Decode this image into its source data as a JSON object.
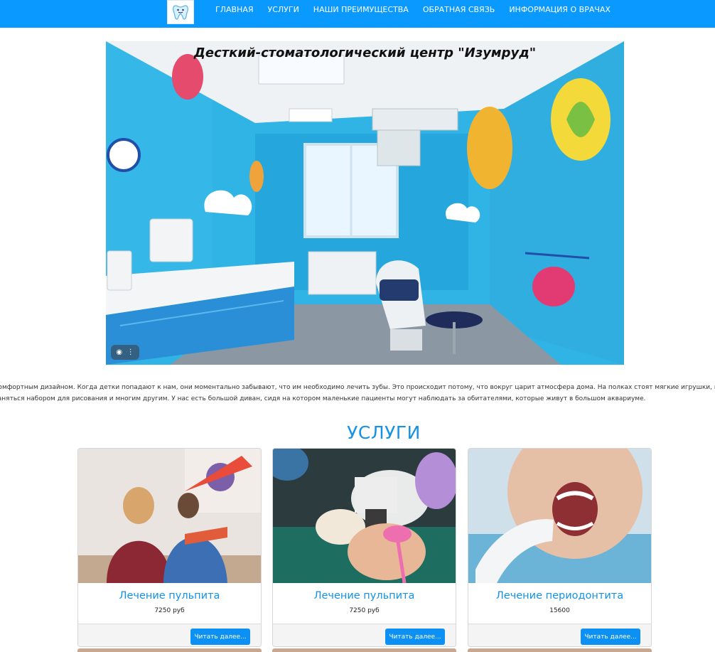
{
  "nav": {
    "items": [
      {
        "label": "ГЛАВНАЯ"
      },
      {
        "label": "УСЛУГИ"
      },
      {
        "label": "НАШИ ПРЕИМУЩЕСТВА"
      },
      {
        "label": "ОБРАТНАЯ СВЯЗЬ"
      },
      {
        "label": "ИНФОРМАЦИЯ О ВРАЧАХ"
      }
    ]
  },
  "hero": {
    "title": "Десткий-стоматологический центр \"Изумруд\""
  },
  "intro": {
    "line1": "комфортным дизайном. Когда детки попадают к нам, они моментально забывают, что им необходимо лечить зубы. Это происходит потому, что вокруг царит атмосфера дома. На полках стоят мягкие игрушки, куклы. Кроме того, ребенок может",
    "line2": "заняться набором для рисования и многим другим. У нас есть большой диван, сидя на котором маленькие пациенты могут наблюдать за обитателями, которые живут в большом аквариуме."
  },
  "services": {
    "title": "УСЛУГИ",
    "cards": [
      {
        "title": "Лечение пульпита",
        "price": "7250 руб",
        "button": "Читать далее..."
      },
      {
        "title": "Лечение пульпита",
        "price": "7250 руб",
        "button": "Читать далее..."
      },
      {
        "title": "Лечение периодонтита",
        "price": "15600",
        "button": "Читать далее..."
      }
    ]
  },
  "colors": {
    "navbar": "#0a9aff",
    "accent": "#1592e6",
    "button": "#0d90f4"
  }
}
